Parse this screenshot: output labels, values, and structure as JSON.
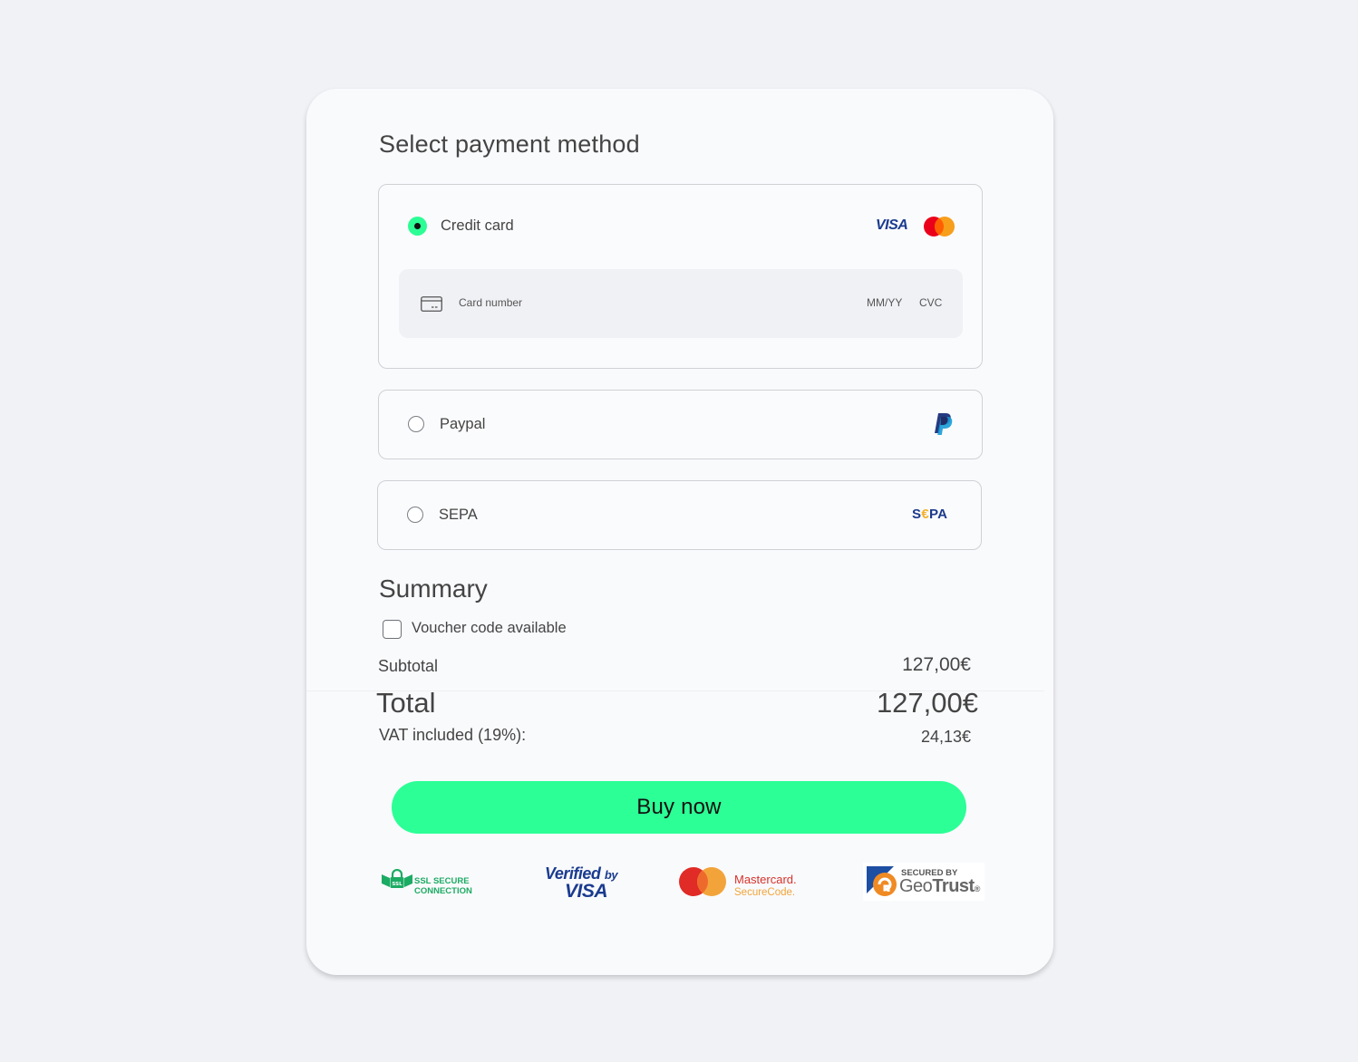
{
  "payment": {
    "title": "Select payment method",
    "methods": [
      {
        "label": "Credit card",
        "selected": true,
        "logos": [
          "visa-icon",
          "mastercard-icon"
        ]
      },
      {
        "label": "Paypal",
        "selected": false,
        "logos": [
          "paypal-icon"
        ]
      },
      {
        "label": "SEPA",
        "selected": false,
        "logos": [
          "sepa-icon"
        ]
      }
    ],
    "card_form": {
      "number_placeholder": "Card number",
      "expiry_placeholder": "MM/YY",
      "cvc_placeholder": "CVC"
    },
    "visa_text": "VISA",
    "sepa_logo": {
      "s": "S",
      "e": "€",
      "pa": "PA"
    }
  },
  "summary": {
    "title": "Summary",
    "voucher_label": "Voucher code available",
    "voucher_checked": false,
    "subtotal_label": "Subtotal",
    "subtotal_value": "127,00€",
    "total_label": "Total",
    "total_value": "127,00€",
    "vat_label": "VAT included (19%):",
    "vat_value": "24,13€"
  },
  "buy_button_label": "Buy now",
  "badges": {
    "ssl": {
      "line1": "SSL SECURE",
      "line2": "CONNECTION",
      "lock_text": "SSL"
    },
    "verified_visa": {
      "verified": "Verified",
      "by": "by",
      "visa": "VISA"
    },
    "mastercard_securecode": {
      "name": "Mastercard.",
      "sub": "SecureCode."
    },
    "geotrust": {
      "small": "SECURED BY",
      "geo": "Geo",
      "trust": "Trust",
      "reg": "®"
    }
  },
  "colors": {
    "accent_green": "#2cfd95",
    "page_bg": "#f1f2f6",
    "card_bg": "#f9fafc",
    "visa_blue": "#1a3b8f",
    "mc_red": "#eb001b",
    "mc_orange": "#f79e1b",
    "paypal_dark": "#253b80",
    "paypal_light": "#179bd7",
    "sepa_yellow": "#f2b22c"
  }
}
